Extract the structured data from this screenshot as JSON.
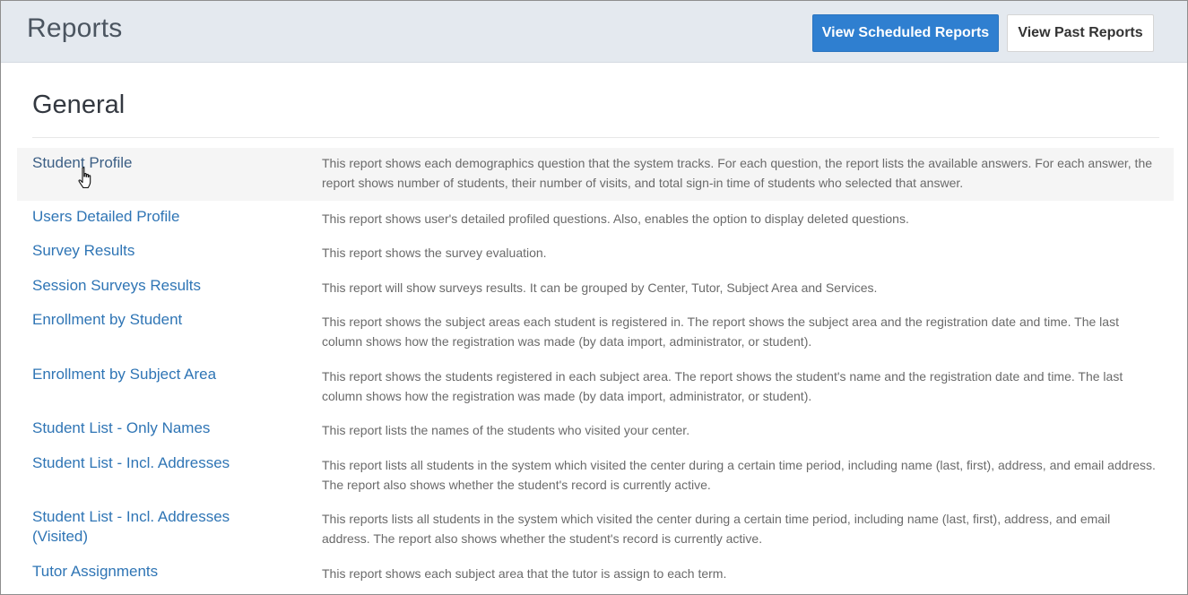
{
  "header": {
    "title": "Reports",
    "scheduled_button": "View Scheduled Reports",
    "past_button": "View Past Reports"
  },
  "colors": {
    "header_bg": "#e4e9ef",
    "primary_button": "#2f7fd0",
    "link": "#2f75b5",
    "description_text": "#6a6a6a"
  },
  "section": {
    "title": "General"
  },
  "reports": [
    {
      "name": "Student Profile",
      "description": "This report shows each demographics question that the system tracks. For each question, the report lists the available answers. For each answer, the report shows number of students, their number of visits, and total sign-in time of students who selected that answer."
    },
    {
      "name": "Users Detailed Profile",
      "description": "This report shows user's detailed profiled questions. Also, enables the option to display deleted questions."
    },
    {
      "name": "Survey Results",
      "description": "This report shows the survey evaluation."
    },
    {
      "name": "Session Surveys Results",
      "description": "This report will show surveys results. It can be grouped by Center, Tutor, Subject Area and Services."
    },
    {
      "name": "Enrollment by Student",
      "description": "This report shows the subject areas each student is registered in. The report shows the subject area and the registration date and time. The last column shows how the registration was made (by data import, administrator, or student)."
    },
    {
      "name": "Enrollment by Subject Area",
      "description": "This report shows the students registered in each subject area. The report shows the student's name and the registration date and time. The last column shows how the registration was made (by data import, administrator, or student)."
    },
    {
      "name": "Student List - Only Names",
      "description": "This report lists the names of the students who visited your center."
    },
    {
      "name": "Student List - Incl. Addresses",
      "description": "This report lists all students in the system which visited the center during a certain time period, including name (last, first), address, and email address. The report also shows whether the student's record is currently active."
    },
    {
      "name": "Student List - Incl. Addresses (Visited)",
      "description": "This reports lists all students in the system which visited the center during a certain time period, including name (last, first), address, and email address. The report also shows whether the student's record is currently active."
    },
    {
      "name": "Tutor Assignments",
      "description": "This report shows each subject area that the tutor is assign to each term."
    }
  ]
}
